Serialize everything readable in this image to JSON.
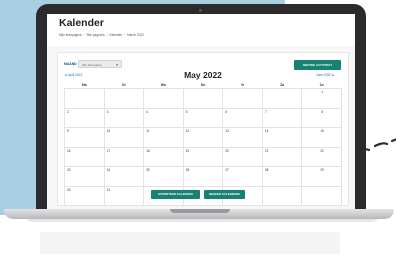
{
  "page": {
    "title": "Kalender",
    "breadcrumbs": [
      "Mijn startpagina",
      "Site pagina's",
      "Kalender",
      "March 2022"
    ]
  },
  "controls": {
    "month_label": "MAAND",
    "month_select_value": "Alle bezoekers",
    "new_event_button": "NIEUWE ACTIVITEIT"
  },
  "calendar": {
    "title": "May 2022",
    "prev_link": "◄ April 2022",
    "next_link": "June 2022 ►",
    "weekdays": [
      "Ma",
      "Di",
      "Wo",
      "Do",
      "Vr",
      "Za",
      "Zo"
    ],
    "weeks": [
      [
        "",
        "",
        "",
        "",
        "",
        "",
        "1"
      ],
      [
        "2",
        "3",
        "4",
        "5",
        "6",
        "7",
        "8"
      ],
      [
        "9",
        "10",
        "11",
        "12",
        "13",
        "14",
        "15"
      ],
      [
        "16",
        "17",
        "18",
        "19",
        "20",
        "21",
        "22"
      ],
      [
        "23",
        "24",
        "25",
        "26",
        "27",
        "28",
        "29"
      ],
      [
        "30",
        "31",
        "",
        "",
        "",
        "",
        ""
      ]
    ]
  },
  "footer": {
    "export_button": "EXPORTEER KALENDER",
    "manage_button": "BEHEER KALENDERS"
  },
  "colors": {
    "accent": "#178271",
    "link": "#0f6cbf",
    "background_panel": "#a9cfe2"
  }
}
